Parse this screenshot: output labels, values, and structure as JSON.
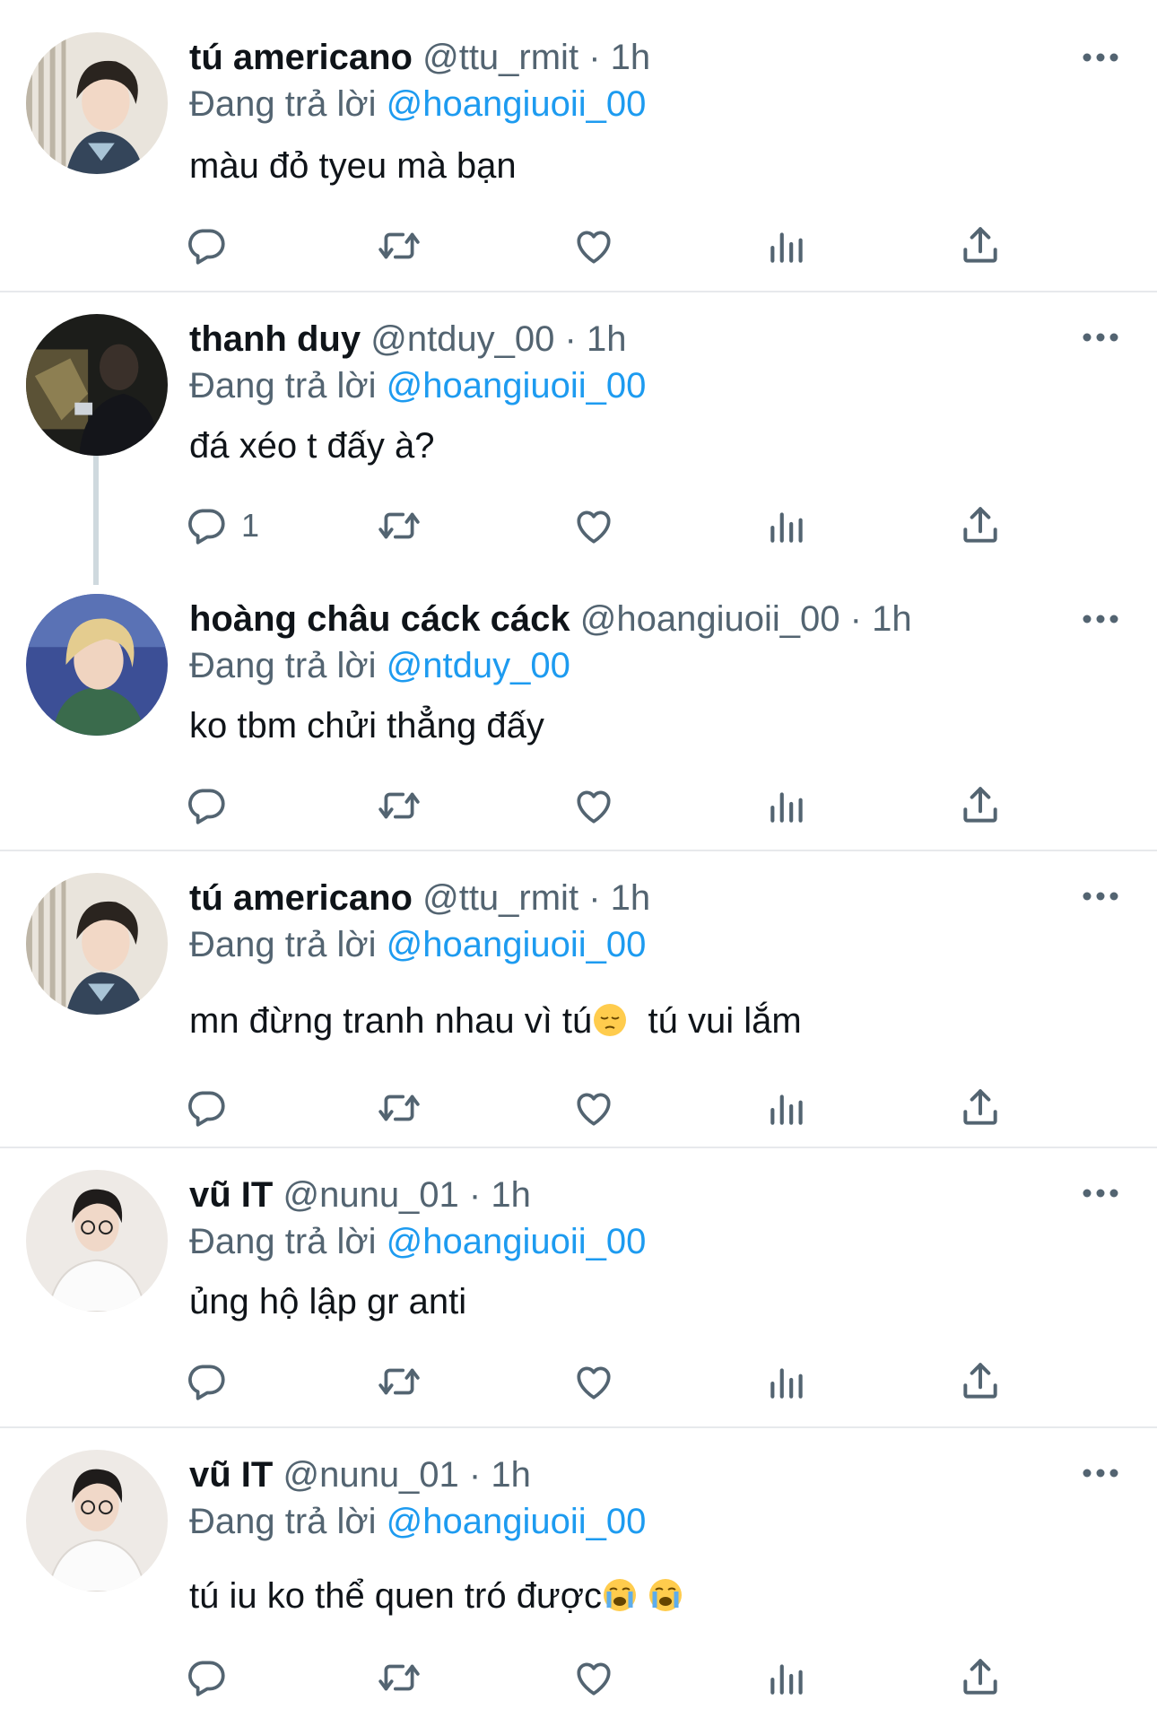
{
  "reply_prefix": "Đang trả lời",
  "colors": {
    "text": "#0f1419",
    "secondary": "#536471",
    "link": "#1d9bf0",
    "divider": "#e7e9ec"
  },
  "tweets": [
    {
      "name": "tú americano",
      "handle": "@ttu_rmit",
      "separator": "·",
      "time": "1h",
      "reply_to": "@hoangiuoii_00",
      "text": "màu đỏ tyeu mà bạn",
      "reply_count": ""
    },
    {
      "name": "thanh duy",
      "handle": "@ntduy_00",
      "separator": "·",
      "time": "1h",
      "reply_to": "@hoangiuoii_00",
      "text": "đá xéo t đấy à?",
      "reply_count": "1"
    },
    {
      "name": "hoàng châu cáck cáck",
      "handle": "@hoangiuoii_00",
      "separator": "·",
      "time": "1h",
      "reply_to": "@ntduy_00",
      "text": "ko tbm chửi thẳng đấy",
      "reply_count": ""
    },
    {
      "name": "tú americano",
      "handle": "@ttu_rmit",
      "separator": "·",
      "time": "1h",
      "reply_to": "@hoangiuoii_00",
      "text_a": "mn đừng tranh nhau vì tú",
      "text_b": "tú vui lắm",
      "emoji_icon": "pensive-face-emoji",
      "reply_count": ""
    },
    {
      "name": "vũ IT",
      "handle": "@nunu_01",
      "separator": "·",
      "time": "1h",
      "reply_to": "@hoangiuoii_00",
      "text": "ủng hộ lập gr anti",
      "reply_count": ""
    },
    {
      "name": "vũ IT",
      "handle": "@nunu_01",
      "separator": "·",
      "time": "1h",
      "reply_to": "@hoangiuoii_00",
      "text": "tú iu ko thể quen tró được",
      "emoji_icon": "crying-face-emoji",
      "reply_count": ""
    }
  ],
  "icons": [
    "reply-icon",
    "retweet-icon",
    "like-icon",
    "views-icon",
    "share-icon",
    "more-icon"
  ]
}
